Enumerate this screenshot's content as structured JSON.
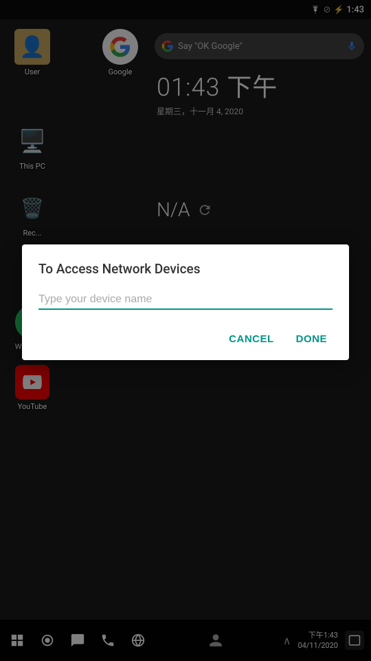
{
  "statusBar": {
    "time": "1:43",
    "wifiIcon": "wifi",
    "simIcon": "no-sim",
    "batteryIcon": "battery-charging"
  },
  "desktop": {
    "icons": [
      {
        "id": "user",
        "label": "User",
        "emoji": "👤",
        "bg": "#c8a860"
      },
      {
        "id": "google",
        "label": "Google",
        "emoji": "G",
        "bg": "#fff"
      },
      {
        "id": "this-pc",
        "label": "This PC",
        "emoji": "🖥️",
        "bg": "transparent"
      },
      {
        "id": "recycle",
        "label": "Rec...",
        "emoji": "🗑️",
        "bg": "transparent"
      },
      {
        "id": "whatsapp",
        "label": "WhatsApp",
        "emoji": "💬",
        "bg": "#25d366"
      },
      {
        "id": "youtube",
        "label": "YouTube",
        "emoji": "▶",
        "bg": "#ff0000"
      }
    ],
    "googleSearch": {
      "placeholder": "Say \"OK Google\""
    },
    "clock": {
      "time": "01:43 下午",
      "date": "星期三，十一月 4, 2020"
    },
    "weather": {
      "value": "N/A"
    }
  },
  "dialog": {
    "title": "To Access Network Devices",
    "inputPlaceholder": "Type your device name",
    "cancelLabel": "CANCEL",
    "doneLabel": "DONE"
  },
  "taskbar": {
    "icons": [
      "⊞",
      "⏺",
      "💬",
      "📞",
      "◎"
    ],
    "time": "下午1:43",
    "date": "04/11/2020"
  }
}
